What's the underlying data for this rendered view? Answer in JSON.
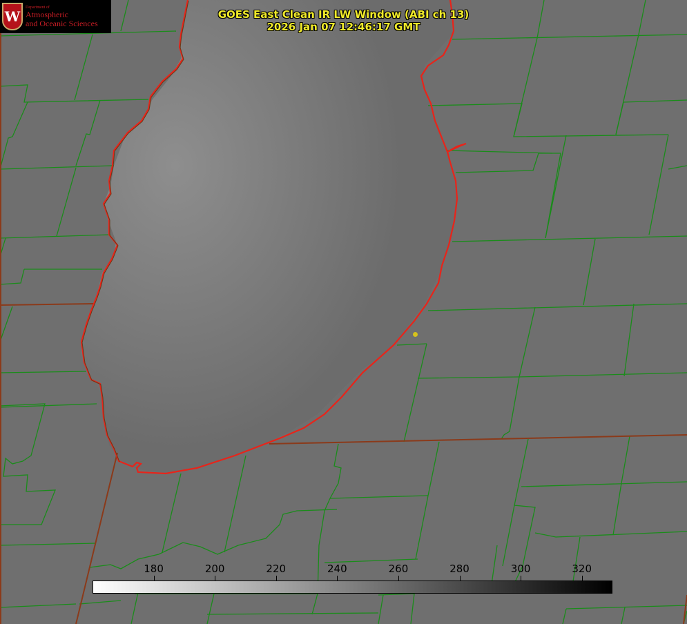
{
  "title": {
    "line1": "GOES East Clean IR LW Window (ABI ch 13)",
    "line2": "2026 Jan 07 12:46:17 GMT"
  },
  "logo": {
    "department": "Department of",
    "line1": "Atmospheric",
    "line2": "and Oceanic Sciences",
    "crest_letter": "W"
  },
  "colorbar": {
    "min": 160,
    "max": 330,
    "ticks": [
      "180",
      "200",
      "220",
      "240",
      "260",
      "280",
      "300",
      "320"
    ],
    "colormap": "white-to-black"
  },
  "colors": {
    "county_lines": "#1a8c1a",
    "state_lines": "#8b3a1a",
    "coastline": "#e8241a",
    "title_text": "#f0ea2a",
    "site_marker": "#d6c21c"
  }
}
